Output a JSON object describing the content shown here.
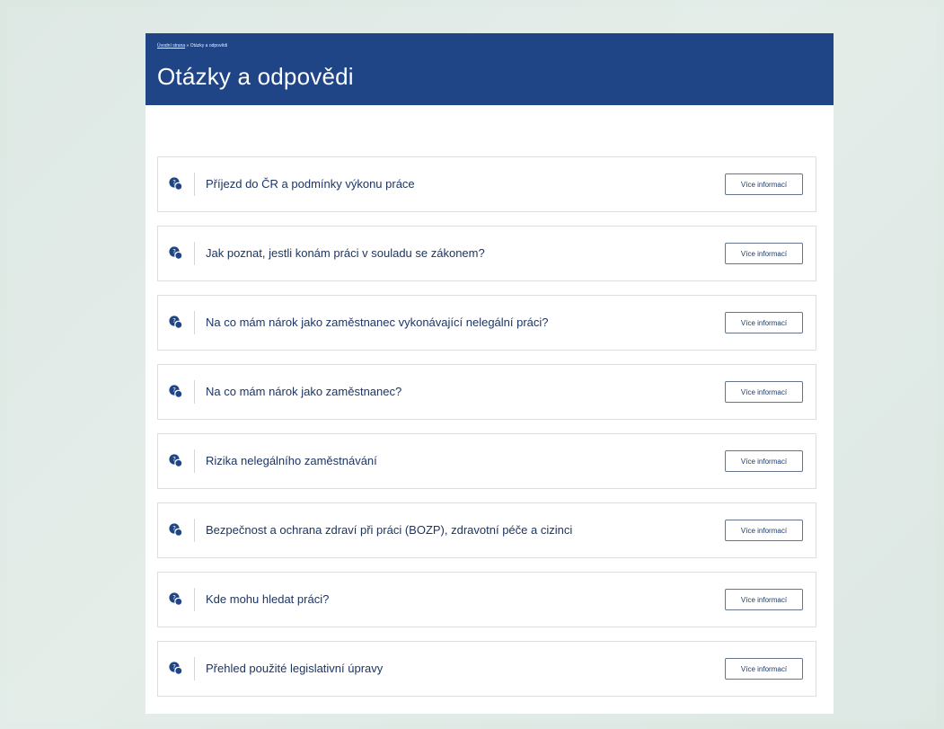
{
  "breadcrumb": {
    "home_label": "Úvodní strana",
    "separator": "»",
    "current_label": "Otázky a odpovědi"
  },
  "page": {
    "title": "Otázky a odpovědi"
  },
  "faq": {
    "items": [
      {
        "label": "Příjezd do ČR a podmínky výkonu práce",
        "button_label": "Více informací",
        "icon": "question-chat-icon"
      },
      {
        "label": "Jak poznat, jestli konám práci v souladu se zákonem?",
        "button_label": "Více informací",
        "icon": "question-chat-icon"
      },
      {
        "label": "Na co mám nárok jako zaměstnanec vykonávající nelegální práci?",
        "button_label": "Více informací",
        "icon": "question-chat-icon"
      },
      {
        "label": "Na co mám nárok jako zaměstnanec?",
        "button_label": "Více informací",
        "icon": "question-chat-icon"
      },
      {
        "label": "Rizika nelegálního zaměstnávání",
        "button_label": "Více informací",
        "icon": "question-chat-icon"
      },
      {
        "label": "Bezpečnost a ochrana zdraví při práci (BOZP), zdravotní péče a cizinci",
        "button_label": "Více informací",
        "icon": "question-chat-icon"
      },
      {
        "label": "Kde mohu hledat práci?",
        "button_label": "Více informací",
        "icon": "question-chat-icon"
      },
      {
        "label": "Přehled použité legislativní úpravy",
        "button_label": "Více informací",
        "icon": "question-chat-icon"
      }
    ]
  },
  "colors": {
    "header": "#1f4586",
    "accent": "#1f3a68",
    "background": "#dce7e2",
    "border": "#dedede"
  }
}
